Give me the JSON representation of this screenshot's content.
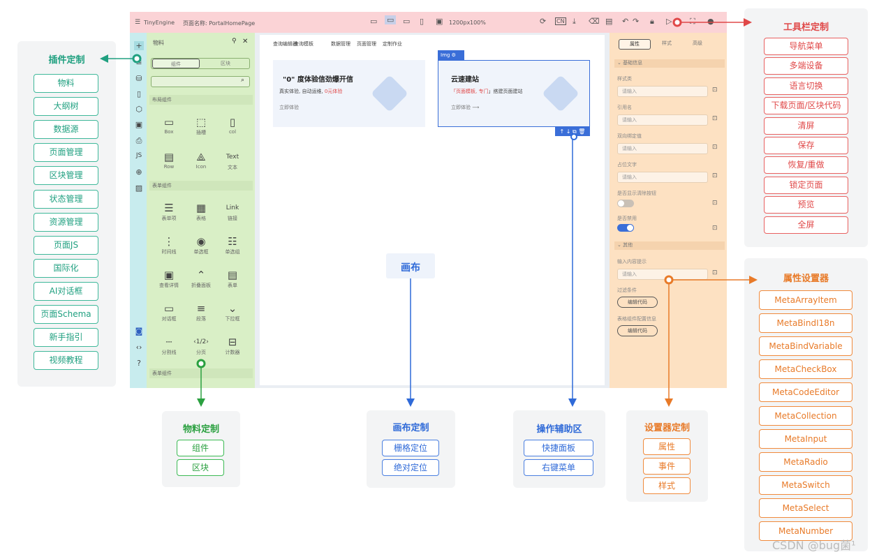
{
  "plugin_group": {
    "title": "插件定制",
    "items": [
      "物料",
      "大纲树",
      "数据源",
      "页面管理",
      "区块管理",
      "状态管理",
      "资源管理",
      "页面JS",
      "国际化",
      "AI对话框",
      "页面Schema",
      "新手指引",
      "视频教程"
    ]
  },
  "toolbar_group": {
    "title": "工具栏定制",
    "items": [
      "导航菜单",
      "多端设备",
      "语言切换",
      "下载页面/区块代码",
      "清屏",
      "保存",
      "恢复/重做",
      "锁定页面",
      "预览",
      "全屏"
    ]
  },
  "props_group": {
    "title": "属性设置器",
    "items": [
      "MetaArrayItem",
      "MetaBindI18n",
      "MetaBindVariable",
      "MetaCheckBox",
      "MetaCodeEditor",
      "MetaCollection",
      "MetaInput",
      "MetaRadio",
      "MetaSwitch",
      "MetaSelect",
      "MetaNumber"
    ]
  },
  "material_group": {
    "title": "物料定制",
    "items": [
      "组件",
      "区块"
    ]
  },
  "canvas_group": {
    "title": "画布定制",
    "items": [
      "栅格定位",
      "绝对定位"
    ]
  },
  "helper_group": {
    "title": "操作辅助区",
    "items": [
      "快捷面板",
      "右键菜单"
    ]
  },
  "setter_group": {
    "title": "设置器定制",
    "items": [
      "属性",
      "事件",
      "样式"
    ]
  },
  "canvas_label": "画布",
  "editor": {
    "topbar": {
      "app": "TinyEngine",
      "page_name": "页面名称: PortalHomePage",
      "size": "1200px",
      "zoom": "100%"
    },
    "material_panel": {
      "title": "物料",
      "tabs": [
        "组件",
        "区块"
      ],
      "section_layout": "布局组件",
      "layout_items": [
        {
          "label": "Box",
          "icon": "▭"
        },
        {
          "label": "插槽",
          "icon": "⬚"
        },
        {
          "label": "col",
          "icon": "▯"
        },
        {
          "label": "Row",
          "icon": "▤"
        },
        {
          "label": "Icon",
          "icon": "⟁"
        },
        {
          "label": "文本",
          "icon": "Text"
        }
      ],
      "section_form": "表单组件",
      "form_items": [
        {
          "label": "表单项",
          "icon": "☰"
        },
        {
          "label": "表格",
          "icon": "▦"
        },
        {
          "label": "链接",
          "icon": "Link"
        },
        {
          "label": "时间线",
          "icon": "⋮"
        },
        {
          "label": "单选框",
          "icon": "◉"
        },
        {
          "label": "单选组",
          "icon": "☷"
        },
        {
          "label": "查看详情",
          "icon": "▣"
        },
        {
          "label": "折叠面板",
          "icon": "⌃"
        },
        {
          "label": "表单",
          "icon": "▤"
        },
        {
          "label": "对话框",
          "icon": "▭"
        },
        {
          "label": "段落",
          "icon": "≡"
        },
        {
          "label": "下拉框",
          "icon": "⌄"
        },
        {
          "label": "分割线",
          "icon": "┈"
        },
        {
          "label": "分页",
          "icon": "‹1/2›"
        },
        {
          "label": "计数器",
          "icon": "⊟"
        }
      ],
      "section_more": "表单组件"
    },
    "canvas": {
      "nav": [
        "查询编辑器",
        "查询模板",
        "数据管理",
        "页面管理",
        "定制作业"
      ],
      "card1": {
        "title": "\"0\" 度体验信劲爆开信",
        "desc_a": "真实体验, 自动运维, ",
        "desc_b": "0元体验",
        "link": "立即体验"
      },
      "card2": {
        "tag": "Img",
        "title": "云速建站",
        "desc_a": "「页面模板, 专门",
        "desc_b": "」搭建页面建站",
        "link": "立即体验"
      }
    },
    "settings": {
      "tabs": [
        "属性",
        "样式",
        "高级"
      ],
      "section_basic": "基础信息",
      "fields": [
        {
          "label": "样式类",
          "placeholder": "请输入"
        },
        {
          "label": "引用名",
          "placeholder": "请输入"
        },
        {
          "label": "双向绑定值",
          "placeholder": "请输入"
        },
        {
          "label": "占位文字",
          "placeholder": "请输入"
        }
      ],
      "toggle1_label": "是否显示清除按钮",
      "toggle2_label": "是否禁用",
      "section_other": "其他",
      "other_field": {
        "label": "输入内容提示",
        "placeholder": "请输入"
      },
      "filter_label": "过滤条件",
      "filter_btn": "编辑代码",
      "table_label": "表格组件配置信息",
      "table_btn": "编辑代码"
    }
  },
  "watermark": "CSDN @bug菌¹",
  "colors": {
    "teal": "#20a080",
    "red": "#e04848",
    "blue": "#2f6ad8",
    "orange": "#e87a28",
    "green": "#2ba040"
  }
}
